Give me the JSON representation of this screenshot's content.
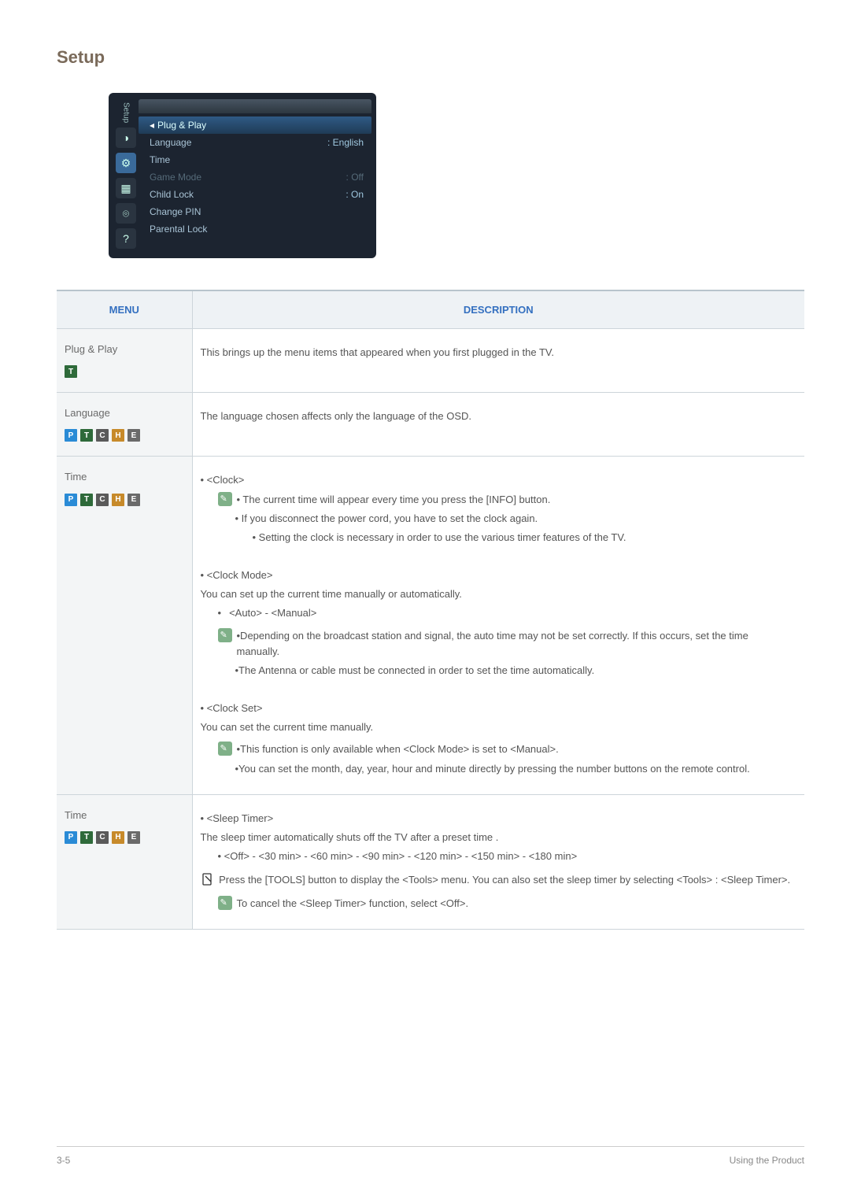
{
  "page": {
    "title": "Setup",
    "footer_left": "3-5",
    "footer_right": "Using the Product"
  },
  "osd": {
    "side_label": "Setup",
    "side_icons": [
      "◑",
      "⚙",
      "▦",
      "⌾",
      "?"
    ],
    "rows": [
      {
        "label": "Plug & Play",
        "value": "",
        "selected": true
      },
      {
        "label": "Language",
        "value": ": English"
      },
      {
        "label": "Time",
        "value": ""
      },
      {
        "label": "Game Mode",
        "value": ": Off",
        "dim": true
      },
      {
        "label": "Child Lock",
        "value": ": On"
      },
      {
        "label": "Change PIN",
        "value": ""
      },
      {
        "label": "Parental Lock",
        "value": ""
      }
    ]
  },
  "table": {
    "headers": {
      "menu": "MENU",
      "desc": "DESCRIPTION"
    },
    "modes_full": [
      "P",
      "T",
      "C",
      "H",
      "E"
    ],
    "rows": [
      {
        "menu": "Plug & Play",
        "modes": [
          "T"
        ],
        "desc_plain": "This brings up the menu items that appeared when you first plugged in the TV."
      },
      {
        "menu": "Language",
        "modes": [
          "P",
          "T",
          "C",
          "H",
          "E"
        ],
        "desc_plain": "The language chosen affects only the language of the OSD."
      },
      {
        "menu": "Time",
        "modes": [
          "P",
          "T",
          "C",
          "H",
          "E"
        ],
        "clock": {
          "heading": "• <Clock>",
          "note1": "• The current time will appear every time you press the [INFO] button.",
          "note2": "• If you disconnect the power cord, you have to set the clock again.",
          "note3": "• Setting the clock is necessary in order to use the various timer features of the TV."
        },
        "clock_mode": {
          "heading": "• <Clock Mode>",
          "line": "You can set up the current time manually or automatically.",
          "options": "<Auto> - <Manual>",
          "note1": "•Depending on the broadcast station and signal, the auto time may not be set correctly. If this occurs, set the time manually.",
          "note2": "•The Antenna or cable must be connected in order to set the time automatically."
        },
        "clock_set": {
          "heading": "• <Clock Set>",
          "line": "You can set the current time manually.",
          "note1": "•This function is only available when <Clock Mode> is set to <Manual>.",
          "note2": "•You can set the month, day, year, hour and minute directly by pressing the number buttons on the remote control."
        }
      },
      {
        "menu": "Time",
        "modes": [
          "P",
          "T",
          "C",
          "H",
          "E"
        ],
        "sleep": {
          "heading": "• <Sleep Timer>",
          "line": "The sleep timer automatically shuts off the TV after a preset time .",
          "options": "• <Off> - <30 min> - <60 min> - <90 min> - <120 min> - <150 min> - <180 min>",
          "tools": "Press the [TOOLS] button to display the <Tools> menu. You can also set the sleep timer by selecting <Tools> : <Sleep Timer>.",
          "cancel": "To cancel the <Sleep Timer> function, select <Off>."
        }
      }
    ]
  }
}
